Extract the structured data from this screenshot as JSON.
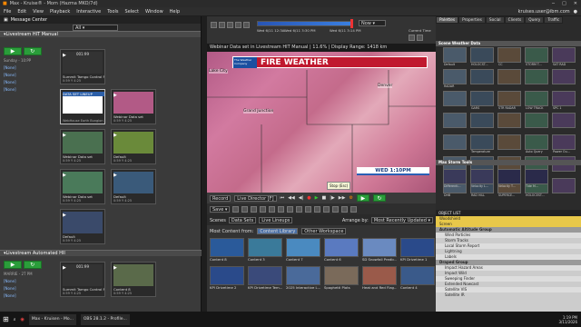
{
  "window": {
    "title": "Max - Kruise® - Mom (Hazma MKO/7d)"
  },
  "menu": {
    "items": [
      "File",
      "Edit",
      "View",
      "Playback",
      "Interactive",
      "Tools",
      "Select",
      "Window",
      "Help"
    ],
    "user": "kruises.user@ibm.com"
  },
  "message_center": {
    "title": "Message Center",
    "dropdown": "All",
    "group1": "Livestream HIT Manual",
    "group2": "Livestream Automated HII",
    "show_label": "Sunday - 10:PP",
    "show_label2": "MARRIE - 2T PM",
    "none": "[None]",
    "tiles1": [
      {
        "time": "001:99",
        "title": "Summit Tamgo Control Fs",
        "sub": "0:59 Y 4:25",
        "btn": "Wherd"
      },
      {
        "time": "",
        "title": "DATA SET LINEUP",
        "sub": "WebHouse Earth Bunglon",
        "btn": ""
      },
      {
        "time": "",
        "title": "Webinar Data set",
        "sub": "0:59 Y 4:25",
        "btn": "Wherd"
      },
      {
        "time": "",
        "title": "Webinar Data set",
        "sub": "0:59 Y 4:25",
        "btn": "Wherd"
      },
      {
        "time": "",
        "title": "Default",
        "sub": "0:59 Y 4:25",
        "btn": ""
      },
      {
        "time": "",
        "title": "Webinar Data set",
        "sub": "0:59 Y 4:25",
        "btn": "Wherd"
      },
      {
        "time": "",
        "title": "Default",
        "sub": "0:59 Y 4:25",
        "btn": ""
      },
      {
        "time": "",
        "title": "Default",
        "sub": "0:59 Y 4:25",
        "btn": ""
      }
    ],
    "tiles2": [
      {
        "time": "001:99",
        "title": "Summit Tamgo Control Fs",
        "sub": "0:59 Y 4:25",
        "btn": "Wherd"
      },
      {
        "time": "",
        "title": "Content 8",
        "sub": "0:59 Y 4:25",
        "btn": "Wherd"
      }
    ]
  },
  "viewer": {
    "header": "Webinar Data set in Livestream HIT Manual | 11.6% | Display Range: 1418 km",
    "banner": "FIRE WEATHER",
    "logo": "The Weather Company",
    "time_label": "WED 1:10PM",
    "cities": [
      "Lake City",
      "Grand Junction",
      "Denver"
    ],
    "tooltip": "Stop (Esc)",
    "timeline_start": "Wed 6/11 12:3A",
    "timeline_mid": "Wed 6/11 3:30 PM",
    "timeline_end": "Wed 6/11 3:14 PM",
    "now_label": "Now",
    "current_time": "Current Time"
  },
  "controls": {
    "record": "Record",
    "live_director": "Live Director [F]",
    "save": "Save"
  },
  "browser": {
    "tabs": [
      "Scenes",
      "Data Sets",
      "Live Lineups"
    ],
    "arrange_by": "Arrange by:",
    "arrange_val": "Most Recently Updated",
    "most_content": "Most Content from:",
    "tab_content": "Content Library",
    "tab_other": "Other Workspace",
    "row1": [
      "Content 8",
      "Content 3",
      "Content 7",
      "Content 6",
      "SD Snowfall Predic...",
      "KPI Drivetime 1"
    ],
    "row2": [
      "KPI Drivetime 2",
      "KPI Drivetime Tem...",
      "2025 Interactive L...",
      "Spaghetti Plots",
      "Heat and Red Flag...",
      "Content 4"
    ]
  },
  "right": {
    "tabs": [
      "Palettes",
      "Properties",
      "Social",
      "Clients",
      "Query",
      "Traffic"
    ],
    "section1": "Scene Weather Data",
    "section2": "Max Storm Tools",
    "thumbs": [
      "Default",
      "HOLOCST...",
      "CC",
      "STORM T...",
      "SAT RAD",
      "RADAR",
      "",
      "",
      "",
      "",
      "",
      "GARS",
      "STR RADAR",
      "LOW TRACK",
      "SPC 1",
      "",
      "",
      "",
      "",
      "",
      "",
      "Temperature",
      "",
      "Auto Query",
      "Power Ou...",
      "",
      "SST",
      "EARTHQ...",
      "",
      "",
      "DHB",
      "RAD HILL",
      "SUPERCE...",
      "HOLOCEST...",
      ""
    ],
    "storm": [
      "Differenti...",
      "Velocity L...",
      "Velocity T...",
      "Tide M..."
    ],
    "objlist_title": "OBJECT LIST",
    "obj": [
      {
        "t": "Woodshield",
        "h": true
      },
      {
        "t": "Screen",
        "h": true
      },
      {
        "t": "Automatic Altitude Group",
        "g": true
      },
      {
        "t": "Wind Particles"
      },
      {
        "t": "Storm Tracks"
      },
      {
        "t": "Local Storm Report"
      },
      {
        "t": "Lightning"
      },
      {
        "t": "Labels"
      },
      {
        "t": "Draped Group",
        "g": true
      },
      {
        "t": "Impact Hazard Areas"
      },
      {
        "t": "Impact Wild"
      },
      {
        "t": "Sweeping Finder"
      },
      {
        "t": "Extended Nowcast"
      },
      {
        "t": "Satellite VIS"
      },
      {
        "t": "Satellite IR"
      }
    ]
  },
  "taskbar": {
    "items": [
      "Max - Kruisen - Mo...",
      "OBS 28.1.2 - Profile..."
    ],
    "time": "1:19 PM",
    "date": "3/11/2026"
  }
}
